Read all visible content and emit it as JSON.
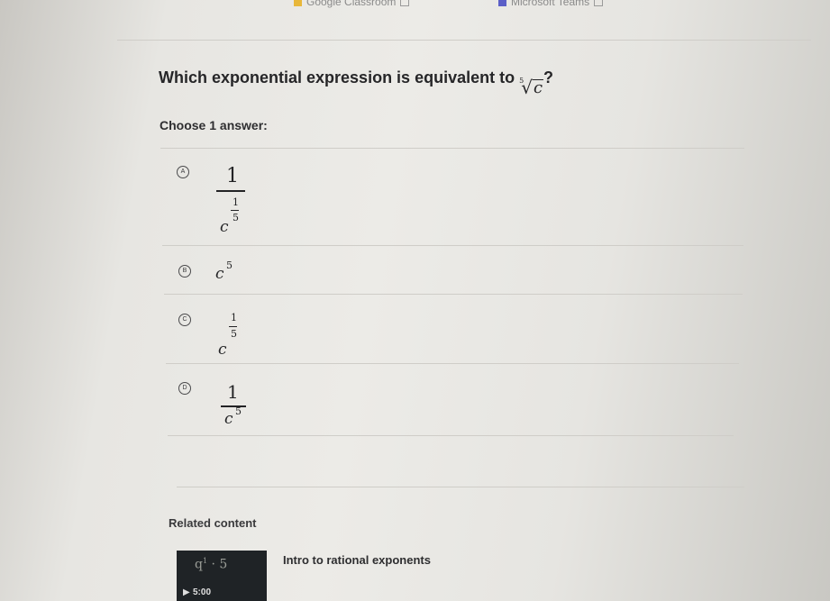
{
  "bookmarks": [
    {
      "label": "Google Classroom",
      "icon": "google-classroom-icon"
    },
    {
      "label": "Microsoft Teams",
      "icon": "microsoft-teams-icon"
    }
  ],
  "question": {
    "prefix": "Which exponential expression is equivalent to ",
    "radical_index": "5",
    "radical_symbol": "√",
    "radicand": "c",
    "suffix": "?"
  },
  "choose_label": "Choose 1 answer:",
  "choices": [
    {
      "letter": "A",
      "numerator": "1",
      "base": "c",
      "exp_num": "1",
      "exp_den": "5"
    },
    {
      "letter": "B",
      "base": "c",
      "exponent": "5"
    },
    {
      "letter": "C",
      "base": "c",
      "exp_num": "1",
      "exp_den": "5"
    },
    {
      "letter": "D",
      "numerator": "1",
      "base": "c",
      "exponent": "5"
    }
  ],
  "related": {
    "heading": "Related content",
    "video": {
      "thumb_text": "q",
      "thumb_sup": "1",
      "thumb_rest": " · 5",
      "duration": "5:00",
      "title": "Intro to rational exponents"
    }
  },
  "colors": {
    "text": "#262628",
    "divider": "#cfcdc8",
    "thumbnail": "#1f2326"
  }
}
